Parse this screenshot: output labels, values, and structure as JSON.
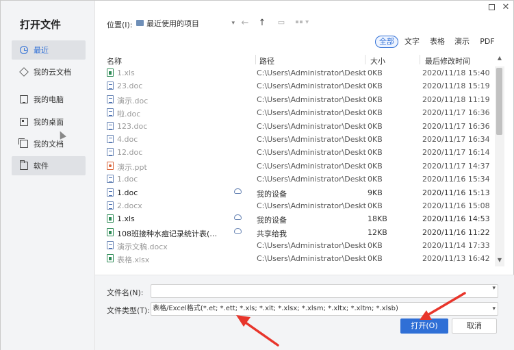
{
  "window": {
    "title": "打开文件",
    "controls": [
      "maximize-icon",
      "close-icon"
    ],
    "close_glyph": "✕"
  },
  "sidebar": {
    "items": [
      {
        "label": "最近",
        "icon": "clock-icon"
      },
      {
        "label": "我的云文档",
        "icon": "cube-icon"
      },
      {
        "label": "我的电脑",
        "icon": "monitor-icon"
      },
      {
        "label": "我的桌面",
        "icon": "desktop-icon"
      },
      {
        "label": "我的文档",
        "icon": "documents-icon"
      },
      {
        "label": "软件",
        "icon": "folder-icon"
      }
    ]
  },
  "toolbar": {
    "location_label": "位置(I):",
    "location_value": "最近使用的项目",
    "back_glyph": "←",
    "up_glyph": "↑"
  },
  "filters": [
    "全部",
    "文字",
    "表格",
    "演示",
    "PDF"
  ],
  "columns": {
    "name": "名称",
    "path": "路径",
    "size": "大小",
    "modified": "最后修改时间"
  },
  "files": [
    {
      "name": "1.xls",
      "type": "xls",
      "path": "C:\\Users\\Administrator\\Deskt...",
      "size": "0KB",
      "modified": "2020/11/18 15:40",
      "dim": true,
      "cloud": false
    },
    {
      "name": "23.doc",
      "type": "doc",
      "path": "C:\\Users\\Administrator\\Deskt...",
      "size": "0KB",
      "modified": "2020/11/18 15:19",
      "dim": true,
      "cloud": false
    },
    {
      "name": "演示.doc",
      "type": "doc",
      "path": "C:\\Users\\Administrator\\Deskt...",
      "size": "0KB",
      "modified": "2020/11/18 11:19",
      "dim": true,
      "cloud": false
    },
    {
      "name": "啦.doc",
      "type": "doc",
      "path": "C:\\Users\\Administrator\\Deskt...",
      "size": "0KB",
      "modified": "2020/11/17 16:36",
      "dim": true,
      "cloud": false
    },
    {
      "name": "123.doc",
      "type": "doc",
      "path": "C:\\Users\\Administrator\\Deskt...",
      "size": "0KB",
      "modified": "2020/11/17 16:36",
      "dim": true,
      "cloud": false
    },
    {
      "name": "4.doc",
      "type": "doc",
      "path": "C:\\Users\\Administrator\\Deskt...",
      "size": "0KB",
      "modified": "2020/11/17 16:34",
      "dim": true,
      "cloud": false
    },
    {
      "name": "12.doc",
      "type": "doc",
      "path": "C:\\Users\\Administrator\\Deskt...",
      "size": "0KB",
      "modified": "2020/11/17 16:14",
      "dim": true,
      "cloud": false
    },
    {
      "name": "演示.ppt",
      "type": "ppt",
      "path": "C:\\Users\\Administrator\\Deskt...",
      "size": "0KB",
      "modified": "2020/11/17 14:37",
      "dim": true,
      "cloud": false
    },
    {
      "name": "1.doc",
      "type": "doc",
      "path": "C:\\Users\\Administrator\\Deskt...",
      "size": "0KB",
      "modified": "2020/11/16 15:34",
      "dim": true,
      "cloud": false
    },
    {
      "name": "1.doc",
      "type": "doc",
      "path": "我的设备",
      "size": "9KB",
      "modified": "2020/11/16 15:13",
      "dim": false,
      "cloud": true
    },
    {
      "name": "2.docx",
      "type": "doc",
      "path": "C:\\Users\\Administrator\\Deskt...",
      "size": "0KB",
      "modified": "2020/11/16 15:08",
      "dim": true,
      "cloud": false
    },
    {
      "name": "1.xls",
      "type": "xls",
      "path": "我的设备",
      "size": "18KB",
      "modified": "2020/11/16 14:53",
      "dim": false,
      "cloud": true
    },
    {
      "name": "108班接种水痘记录统计表(1)....",
      "type": "xls",
      "path": "共享给我",
      "size": "12KB",
      "modified": "2020/11/16 11:22",
      "dim": false,
      "cloud": true
    },
    {
      "name": "演示文稿.docx",
      "type": "doc",
      "path": "C:\\Users\\Administrator\\Deskt...",
      "size": "0KB",
      "modified": "2020/11/14 17:33",
      "dim": true,
      "cloud": false
    },
    {
      "name": "表格.xlsx",
      "type": "xls",
      "path": "C:\\Users\\Administrator\\Deskt...",
      "size": "0KB",
      "modified": "2020/11/13 16:42",
      "dim": true,
      "cloud": false
    }
  ],
  "footer": {
    "filename_label": "文件名(N):",
    "filename_value": "",
    "filetype_label": "文件类型(T):",
    "filetype_value": "表格/Excel格式(*.et; *.ett; *.xls; *.xlt; *.xlsx; *.xlsm; *.xltx; *.xltm; *.xlsb)",
    "open_label": "打开(O)",
    "cancel_label": "取消"
  },
  "colors": {
    "accent": "#2f6fd6",
    "annotation": "#e8352b"
  }
}
